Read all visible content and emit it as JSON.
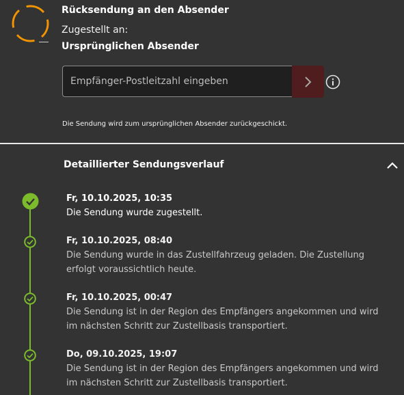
{
  "header": {
    "title": "Rücksendung an den Absender",
    "delivered_label": "Zugestellt an:",
    "delivered_value": "Ursprünglichen Absender"
  },
  "zip": {
    "placeholder": "Empfänger-Postleitzahl eingeben",
    "value": "",
    "note": "Die Sendung wird zum ursprünglichen Absender zurückgeschickt."
  },
  "icons": {
    "status": "circle-dashed-icon",
    "submit": "chevron-right-icon",
    "info": "info-icon",
    "collapse": "chevron-up-icon",
    "event": "check-circle-icon"
  },
  "colors": {
    "accent_orange": "#f29400",
    "success_green": "#7bbb2c",
    "submit_bg": "#4f1d1d"
  },
  "history": {
    "title": "Detaillierter Sendungsverlauf",
    "events": [
      {
        "time": "Fr, 10.10.2025, 10:35",
        "text": "Die Sendung wurde zugestellt."
      },
      {
        "time": "Fr, 10.10.2025, 08:40",
        "text": "Die Sendung wurde in das Zustellfahrzeug geladen. Die Zustellung erfolgt voraussichtlich heute."
      },
      {
        "time": "Fr, 10.10.2025, 00:47",
        "text": "Die Sendung ist in der Region des Empfängers angekommen und wird im nächsten Schritt zur Zustellbasis transportiert."
      },
      {
        "time": "Do, 09.10.2025, 19:07",
        "text": "Die Sendung ist in der Region des Empfängers angekommen und wird im nächsten Schritt zur Zustellbasis transportiert."
      }
    ]
  }
}
